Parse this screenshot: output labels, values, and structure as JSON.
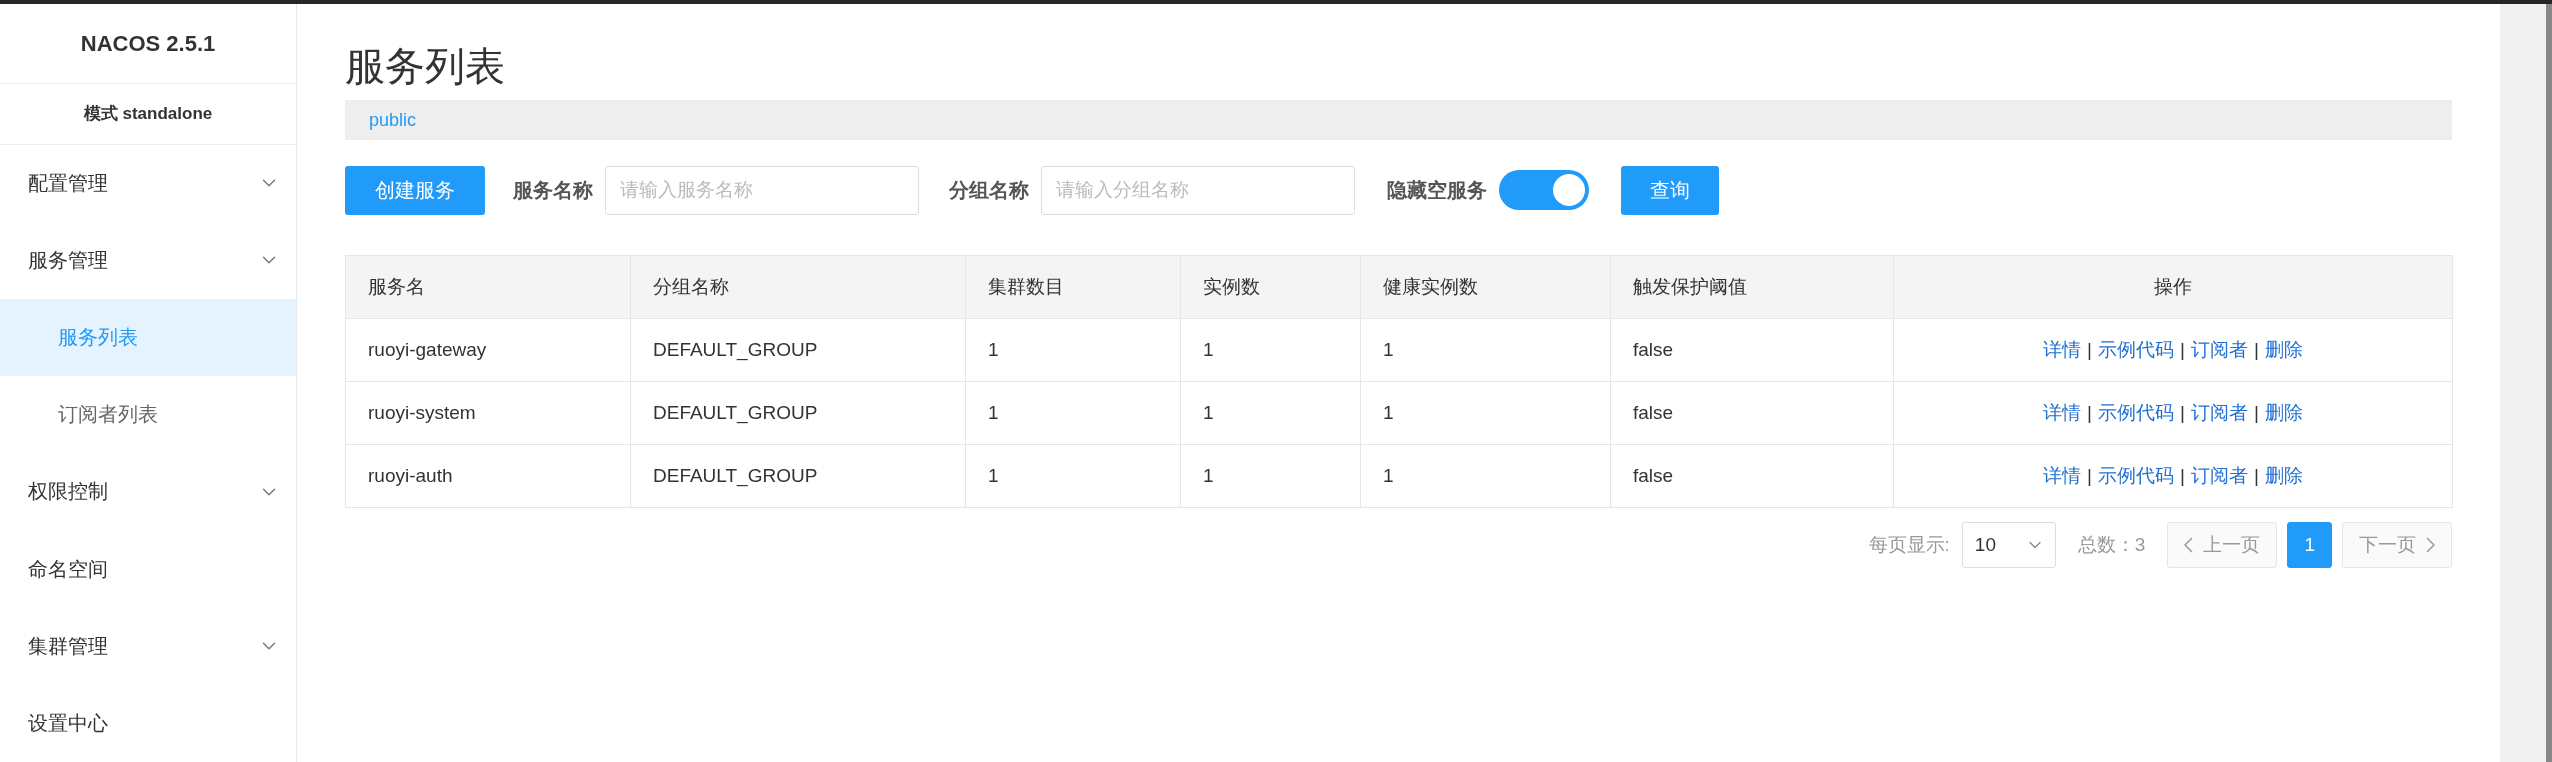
{
  "sidebar": {
    "title": "NACOS 2.5.1",
    "mode": "模式 standalone",
    "items": [
      {
        "label": "配置管理",
        "kind": "submenu",
        "selected": false
      },
      {
        "label": "服务管理",
        "kind": "submenu",
        "selected": false,
        "children": [
          {
            "label": "服务列表",
            "selected": true
          },
          {
            "label": "订阅者列表",
            "selected": false
          }
        ]
      },
      {
        "label": "权限控制",
        "kind": "submenu",
        "selected": false
      },
      {
        "label": "命名空间",
        "kind": "item",
        "selected": false
      },
      {
        "label": "集群管理",
        "kind": "submenu",
        "selected": false
      },
      {
        "label": "设置中心",
        "kind": "item",
        "selected": false
      }
    ]
  },
  "page_title": "服务列表",
  "namespace": "public",
  "toolbar": {
    "create_button": "创建服务",
    "service_name_label": "服务名称",
    "service_name_placeholder": "请输入服务名称",
    "group_name_label": "分组名称",
    "group_name_placeholder": "请输入分组名称",
    "hide_empty_label": "隐藏空服务",
    "hide_empty_on": true,
    "query_button": "查询"
  },
  "table": {
    "columns": [
      "服务名",
      "分组名称",
      "集群数目",
      "实例数",
      "健康实例数",
      "触发保护阈值",
      "操作"
    ],
    "rows": [
      {
        "cells": [
          "ruoyi-gateway",
          "DEFAULT_GROUP",
          "1",
          "1",
          "1",
          "false"
        ],
        "actions": [
          {
            "kind": "link",
            "label": "详情"
          },
          {
            "kind": "separator",
            "label": "|"
          },
          {
            "kind": "link",
            "label": "示例代码"
          },
          {
            "kind": "separator",
            "label": "|"
          },
          {
            "kind": "link",
            "label": "订阅者"
          },
          {
            "kind": "separator",
            "label": "|"
          },
          {
            "kind": "link",
            "label": "删除"
          }
        ]
      },
      {
        "cells": [
          "ruoyi-system",
          "DEFAULT_GROUP",
          "1",
          "1",
          "1",
          "false"
        ],
        "actions": [
          {
            "kind": "link",
            "label": "详情"
          },
          {
            "kind": "separator",
            "label": "|"
          },
          {
            "kind": "link",
            "label": "示例代码"
          },
          {
            "kind": "separator",
            "label": "|"
          },
          {
            "kind": "link",
            "label": "订阅者"
          },
          {
            "kind": "separator",
            "label": "|"
          },
          {
            "kind": "link",
            "label": "删除"
          }
        ]
      },
      {
        "cells": [
          "ruoyi-auth",
          "DEFAULT_GROUP",
          "1",
          "1",
          "1",
          "false"
        ],
        "actions": [
          {
            "kind": "link",
            "label": "详情"
          },
          {
            "kind": "separator",
            "label": "|"
          },
          {
            "kind": "link",
            "label": "示例代码"
          },
          {
            "kind": "separator",
            "label": "|"
          },
          {
            "kind": "link",
            "label": "订阅者"
          },
          {
            "kind": "separator",
            "label": "|"
          },
          {
            "kind": "link",
            "label": "删除"
          }
        ]
      }
    ]
  },
  "pagination": {
    "page_size_label": "每页显示:",
    "page_size": "10",
    "total": "总数：3",
    "prev": {
      "label": "上一页",
      "disabled": true
    },
    "pages": [
      {
        "label": "1",
        "selected": true
      }
    ],
    "next": {
      "label": "下一页",
      "disabled": true
    }
  }
}
